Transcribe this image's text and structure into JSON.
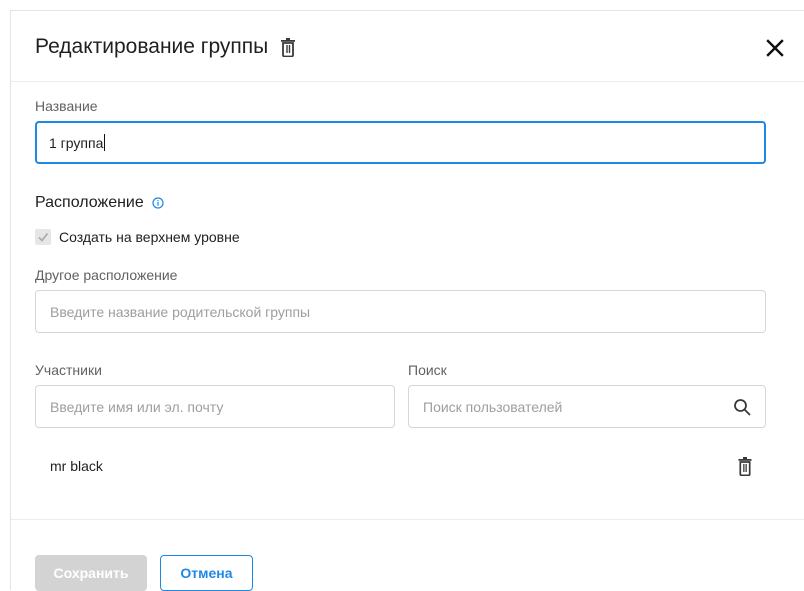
{
  "dialog": {
    "title": "Редактирование группы",
    "title_delete_icon": "trash-icon",
    "close_icon": "close-icon"
  },
  "name_field": {
    "label": "Название",
    "value": "1 группа"
  },
  "location": {
    "title": "Расположение",
    "info_icon": "info-icon",
    "top_level_checkbox": {
      "label": "Создать на верхнем уровне",
      "checked": true
    },
    "other_location": {
      "label": "Другое расположение",
      "placeholder": "Введите название родительской группы"
    }
  },
  "members": {
    "label": "Участники",
    "placeholder": "Введите имя или эл. почту",
    "list": [
      {
        "name": "mr black",
        "delete_icon": "trash-icon"
      }
    ]
  },
  "search": {
    "label": "Поиск",
    "placeholder": "Поиск пользователей",
    "icon": "search-icon"
  },
  "footer": {
    "save_label": "Сохранить",
    "cancel_label": "Отмена"
  },
  "colors": {
    "accent": "#1e88e5",
    "disabled_button": "#d3d3d3"
  }
}
